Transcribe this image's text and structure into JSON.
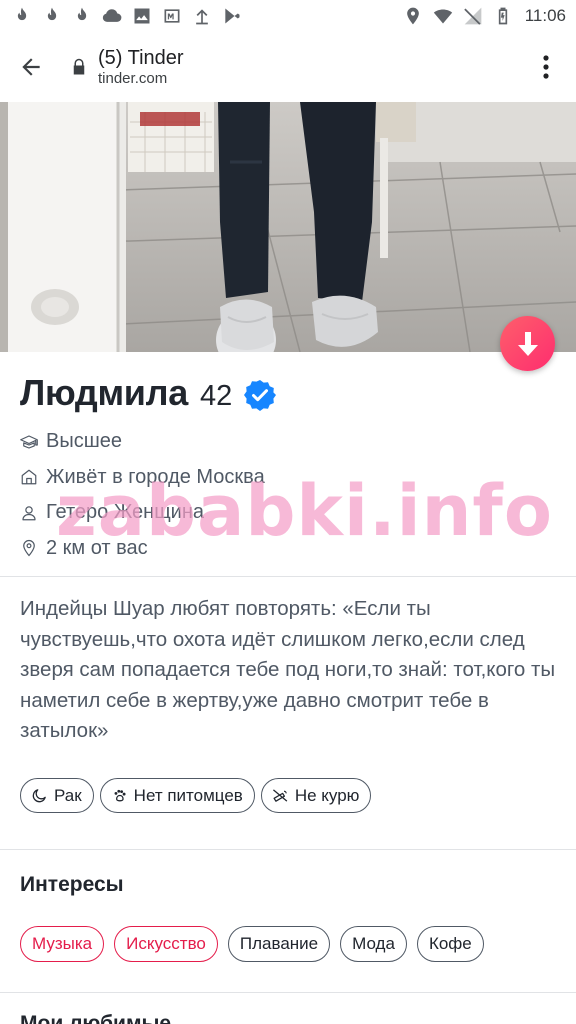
{
  "status_bar": {
    "left_icons": [
      "tinder-flame-icon",
      "tinder-flame-icon",
      "tinder-flame-icon",
      "cloud-icon",
      "image-icon",
      "m-app-icon",
      "upload-icon",
      "play-store-icon"
    ],
    "right_icons": [
      "location-icon",
      "wifi-icon",
      "no-signal-icon",
      "battery-icon"
    ],
    "time": "11:06"
  },
  "browser": {
    "title": "(5) Tinder",
    "domain": "tinder.com"
  },
  "profile": {
    "name": "Людмила",
    "age": "42",
    "verified": true,
    "info": [
      {
        "icon": "education-icon",
        "text": "Высшее"
      },
      {
        "icon": "home-icon",
        "text": "Живёт в городе Москва"
      },
      {
        "icon": "person-icon",
        "text": "Гетеро Женщина"
      },
      {
        "icon": "location-pin-icon",
        "text": "2 км от вас"
      }
    ],
    "bio": "Индейцы Шуар любят повторять: «Если ты чувствуешь,что охота идёт слишком легко,если след зверя сам попадается тебе под ноги,то знай: тот,кого ты наметил себе в жертву,уже давно смотрит тебе в затылок»",
    "tags": [
      {
        "icon": "moon-icon",
        "label": "Рак"
      },
      {
        "icon": "paw-icon",
        "label": "Нет питомцев"
      },
      {
        "icon": "no-smoking-icon",
        "label": "Не курю"
      }
    ]
  },
  "interests": {
    "title": "Интересы",
    "items": [
      {
        "label": "Музыка",
        "shared": true
      },
      {
        "label": "Искусство",
        "shared": true
      },
      {
        "label": "Плавание",
        "shared": false
      },
      {
        "label": "Мода",
        "shared": false
      },
      {
        "label": "Кофе",
        "shared": false
      }
    ]
  },
  "next_section": {
    "title": "Мои любимые"
  },
  "watermark": "zababki.info",
  "colors": {
    "accent": "#fd5068",
    "shared_interest": "#e41d4b",
    "verified": "#1786ff",
    "text_primary": "#21262e",
    "text_secondary": "#505965"
  }
}
